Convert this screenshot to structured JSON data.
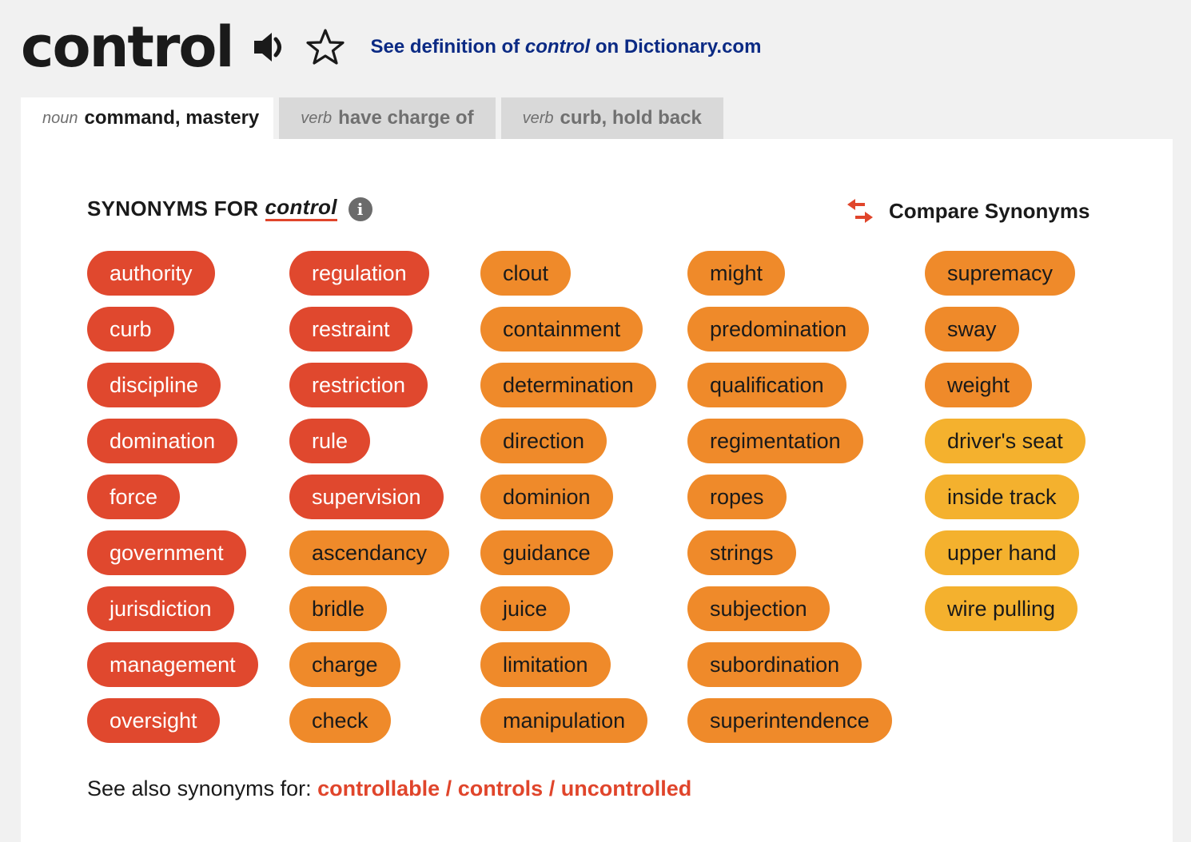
{
  "headword": "control",
  "icons": {
    "speaker": "speaker-icon",
    "star": "star-icon",
    "info": "info-icon",
    "compare": "compare-arrows-icon"
  },
  "definition_link": {
    "prefix": "See definition of ",
    "word": "control",
    "suffix": " on Dictionary.com"
  },
  "tabs": [
    {
      "pos": "noun",
      "sense": "command, mastery",
      "active": true
    },
    {
      "pos": "verb",
      "sense": "have charge of",
      "active": false
    },
    {
      "pos": "verb",
      "sense": "curb, hold back",
      "active": false
    }
  ],
  "synonyms_heading": {
    "label": "SYNONYMS FOR",
    "word": "control"
  },
  "compare_label": "Compare Synonyms",
  "colors": {
    "most_relevant": "#e0482e",
    "relevant": "#ef8a2a",
    "less_relevant": "#f4b12e",
    "link": "#0b2a84",
    "accent": "#e0452b"
  },
  "columns": [
    [
      {
        "w": "authority",
        "t": 1
      },
      {
        "w": "curb",
        "t": 1
      },
      {
        "w": "discipline",
        "t": 1
      },
      {
        "w": "domination",
        "t": 1
      },
      {
        "w": "force",
        "t": 1
      },
      {
        "w": "government",
        "t": 1
      },
      {
        "w": "jurisdiction",
        "t": 1
      },
      {
        "w": "management",
        "t": 1
      },
      {
        "w": "oversight",
        "t": 1
      }
    ],
    [
      {
        "w": "regulation",
        "t": 1
      },
      {
        "w": "restraint",
        "t": 1
      },
      {
        "w": "restriction",
        "t": 1
      },
      {
        "w": "rule",
        "t": 1
      },
      {
        "w": "supervision",
        "t": 1
      },
      {
        "w": "ascendancy",
        "t": 2
      },
      {
        "w": "bridle",
        "t": 2
      },
      {
        "w": "charge",
        "t": 2
      },
      {
        "w": "check",
        "t": 2
      }
    ],
    [
      {
        "w": "clout",
        "t": 2
      },
      {
        "w": "containment",
        "t": 2
      },
      {
        "w": "determination",
        "t": 2
      },
      {
        "w": "direction",
        "t": 2
      },
      {
        "w": "dominion",
        "t": 2
      },
      {
        "w": "guidance",
        "t": 2
      },
      {
        "w": "juice",
        "t": 2
      },
      {
        "w": "limitation",
        "t": 2
      },
      {
        "w": "manipulation",
        "t": 2
      }
    ],
    [
      {
        "w": "might",
        "t": 2
      },
      {
        "w": "predomination",
        "t": 2
      },
      {
        "w": "qualification",
        "t": 2
      },
      {
        "w": "regimentation",
        "t": 2
      },
      {
        "w": "ropes",
        "t": 2
      },
      {
        "w": "strings",
        "t": 2
      },
      {
        "w": "subjection",
        "t": 2
      },
      {
        "w": "subordination",
        "t": 2
      },
      {
        "w": "superintendence",
        "t": 2
      }
    ],
    [
      {
        "w": "supremacy",
        "t": 2
      },
      {
        "w": "sway",
        "t": 2
      },
      {
        "w": "weight",
        "t": 2
      },
      {
        "w": "driver's seat",
        "t": 3
      },
      {
        "w": "inside track",
        "t": 3
      },
      {
        "w": "upper hand",
        "t": 3
      },
      {
        "w": "wire pulling",
        "t": 3
      }
    ]
  ],
  "see_also": {
    "label": "See also synonyms for: ",
    "links": [
      "controllable",
      "controls",
      "uncontrolled"
    ],
    "separator": " / "
  }
}
